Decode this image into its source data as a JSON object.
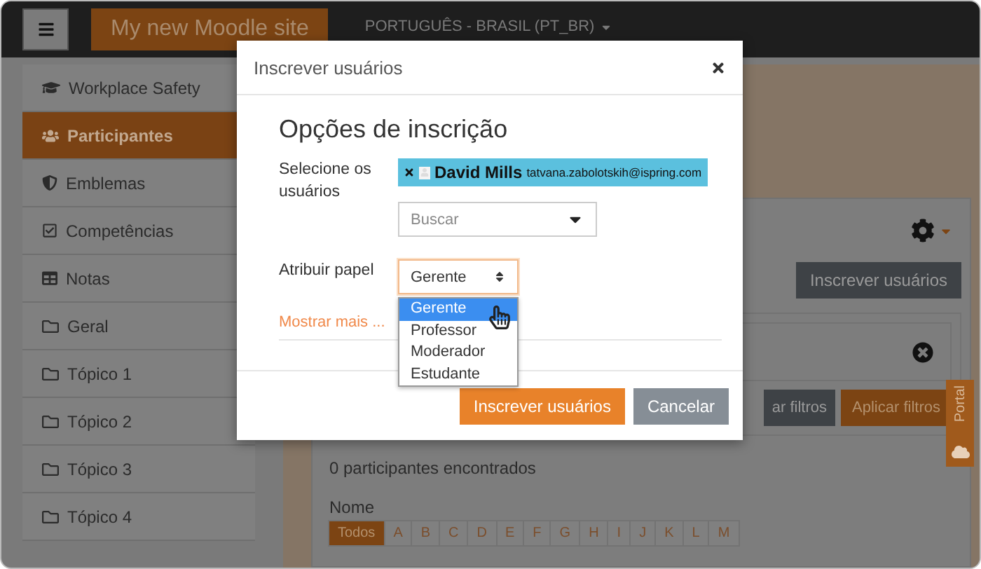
{
  "navbar": {
    "site_name": "My new Moodle site",
    "language": "PORTUGUÊS - BRASIL (PT_BR)"
  },
  "sidebar": {
    "items": [
      {
        "label": "Workplace Safety",
        "kind": "course",
        "selected": false
      },
      {
        "label": "Participantes",
        "kind": "participants",
        "selected": true
      },
      {
        "label": "Emblemas",
        "kind": "badges",
        "selected": false
      },
      {
        "label": "Competências",
        "kind": "competencies",
        "selected": false
      },
      {
        "label": "Notas",
        "kind": "grades",
        "selected": false
      },
      {
        "label": "Geral",
        "kind": "section",
        "selected": false
      },
      {
        "label": "Tópico 1",
        "kind": "section",
        "selected": false
      },
      {
        "label": "Tópico 2",
        "kind": "section",
        "selected": false
      },
      {
        "label": "Tópico 3",
        "kind": "section",
        "selected": false
      },
      {
        "label": "Tópico 4",
        "kind": "section",
        "selected": false
      }
    ]
  },
  "main": {
    "enrol_button": "Inscrever usuários",
    "filter_buttons": [
      {
        "label": "ar filtros",
        "kind": "secondary"
      },
      {
        "label": "Aplicar filtros",
        "kind": "primary"
      }
    ],
    "count": "0 participantes encontrados",
    "name_filter": {
      "label": "Nome",
      "letters": [
        {
          "label": "Todos",
          "selected": true
        },
        {
          "label": "A",
          "selected": false
        },
        {
          "label": "B",
          "selected": false
        },
        {
          "label": "C",
          "selected": false
        },
        {
          "label": "D",
          "selected": false
        },
        {
          "label": "E",
          "selected": false
        },
        {
          "label": "F",
          "selected": false
        },
        {
          "label": "G",
          "selected": false
        },
        {
          "label": "H",
          "selected": false
        },
        {
          "label": "I",
          "selected": false
        },
        {
          "label": "J",
          "selected": false
        },
        {
          "label": "K",
          "selected": false
        },
        {
          "label": "L",
          "selected": false
        },
        {
          "label": "M",
          "selected": false
        }
      ]
    }
  },
  "portal_tab": {
    "label": "Portal"
  },
  "modal": {
    "title": "Inscrever usuários",
    "heading": "Opções de inscrição",
    "users_field": {
      "label": "Selecione os usuários",
      "selected_users": [
        {
          "name": "David Mills",
          "email": "tatvana.zabolotskih@ispring.com"
        }
      ],
      "search": {
        "placeholder": "Buscar"
      }
    },
    "role_field": {
      "label": "Atribuir papel",
      "value": "Gerente",
      "expanded": true,
      "options": [
        {
          "label": "Gerente",
          "selected": true
        },
        {
          "label": "Professor",
          "selected": false
        },
        {
          "label": "Moderador",
          "selected": false
        },
        {
          "label": "Estudante",
          "selected": false
        }
      ]
    },
    "show_more": "Mostrar mais ...",
    "buttons": [
      {
        "label": "Inscrever usuários",
        "kind": "primary"
      },
      {
        "label": "Cancelar",
        "kind": "secondary"
      }
    ]
  }
}
